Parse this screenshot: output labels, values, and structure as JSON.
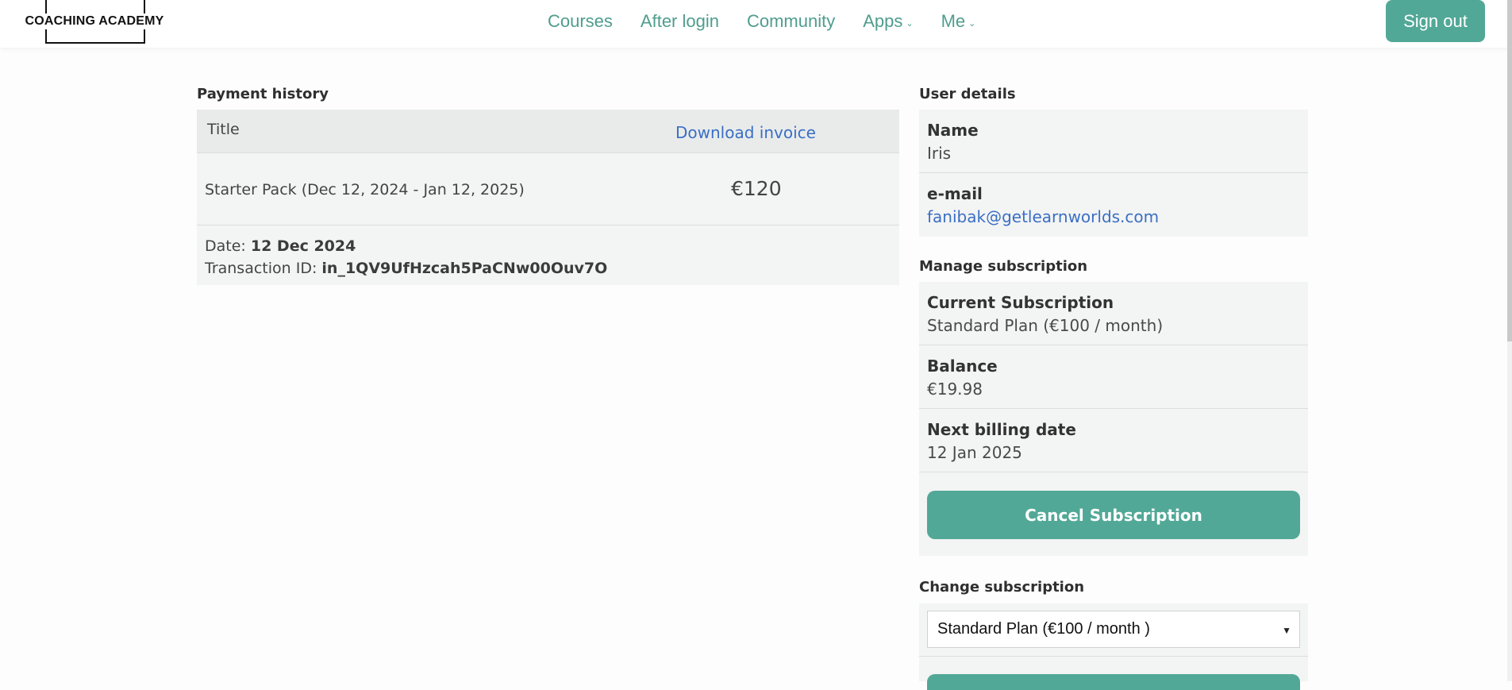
{
  "header": {
    "logo_text": "COACHING ACADEMY",
    "nav": [
      {
        "label": "Courses"
      },
      {
        "label": "After login"
      },
      {
        "label": "Community"
      },
      {
        "label": "Apps"
      },
      {
        "label": "Me"
      }
    ],
    "signout_label": "Sign out"
  },
  "payment_history": {
    "title": "Payment history",
    "col_title": "Title",
    "col_download": "Download invoice",
    "row": {
      "title": "Starter Pack (Dec 12, 2024 - Jan 12, 2025)",
      "amount": "€120"
    },
    "date_label": "Date:",
    "date_value": "12 Dec 2024",
    "txn_label": "Transaction ID:",
    "txn_value": "in_1QV9UfHzcah5PaCNw00Ouv7O"
  },
  "user_details": {
    "title": "User details",
    "name_label": "Name",
    "name_value": "Iris",
    "email_label": "e-mail",
    "email_value": "fanibak@getlearnworlds.com"
  },
  "manage_subscription": {
    "title": "Manage subscription",
    "current_label": "Current Subscription",
    "current_value": "Standard Plan (€100 / month)",
    "balance_label": "Balance",
    "balance_value": "€19.98",
    "next_label": "Next billing date",
    "next_value": "12 Jan 2025",
    "cancel_label": "Cancel Subscription"
  },
  "change_subscription": {
    "title": "Change subscription",
    "selected": "Standard Plan (€100 / month )"
  },
  "colors": {
    "accent": "#52a897",
    "nav_text": "#4f9d8e",
    "link": "#3a6fc4"
  }
}
